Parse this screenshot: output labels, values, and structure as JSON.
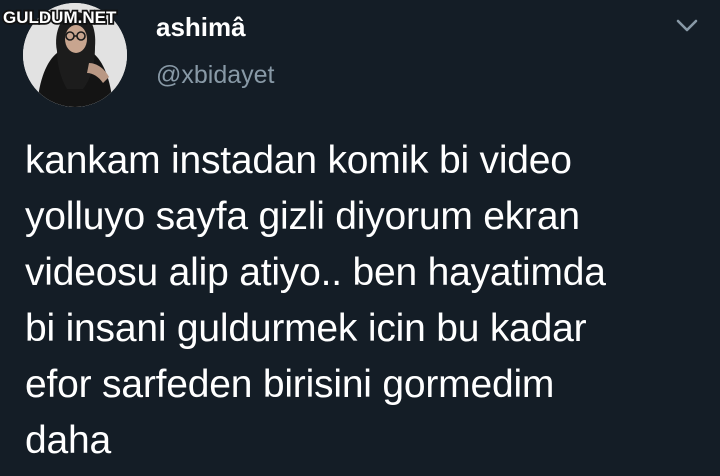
{
  "watermark": {
    "text": "GULDUM.NET"
  },
  "user": {
    "display_name": "ashimâ",
    "handle": "@xbidayet"
  },
  "tweet": {
    "lines": [
      "kankam instadan komik bi video",
      "yolluyo sayfa gizli diyorum ekran",
      "videosu alip atiyo.. ben hayatimda",
      "bi insani guldurmek icin bu kadar",
      "efor sarfeden birisini gormedim",
      "daha"
    ]
  },
  "icons": {
    "menu": "chevron-down-icon",
    "avatar": "avatar"
  },
  "colors": {
    "background": "#141d26",
    "text_primary": "#ffffff",
    "text_secondary": "#8899a6"
  }
}
